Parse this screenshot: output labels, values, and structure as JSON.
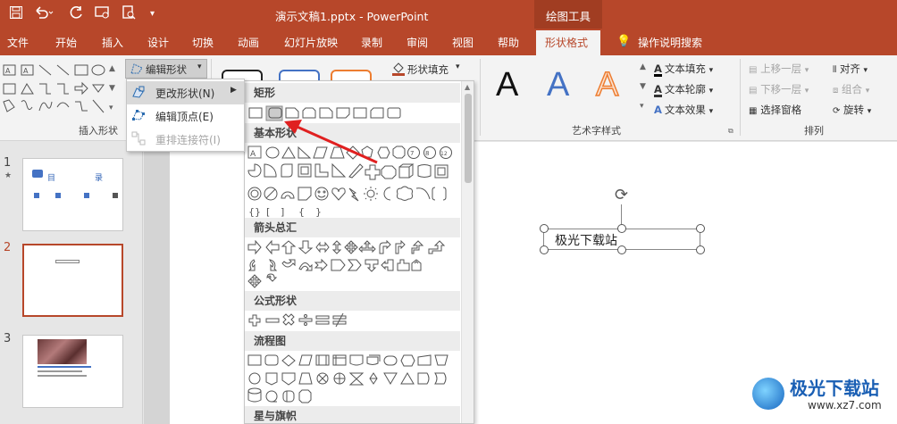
{
  "titlebar": {
    "doc_title": "演示文稿1.pptx  -  PowerPoint",
    "context_tool": "绘图工具"
  },
  "tabs": [
    "文件",
    "开始",
    "插入",
    "设计",
    "切换",
    "动画",
    "幻灯片放映",
    "录制",
    "审阅",
    "视图",
    "帮助",
    "形状格式"
  ],
  "tell_me": "操作说明搜索",
  "ribbon": {
    "edit_shape": "编辑形状",
    "shape_fill": "形状填充",
    "insert_shapes_label": "插入形状",
    "art_label": "艺术字样式",
    "arrange_label": "排列",
    "text_fill": "文本填充",
    "text_outline": "文本轮廓",
    "text_effects": "文本效果",
    "bring_forward": "上移一层",
    "send_backward": "下移一层",
    "selection_pane": "选择窗格",
    "align": "对齐",
    "group": "组合",
    "rotate": "旋转",
    "wordart_letter": "A"
  },
  "menu": {
    "change_shape": "更改形状(N)",
    "edit_points": "编辑顶点(E)",
    "reroute": "重排连接符(I)"
  },
  "gallery": {
    "sections": [
      "矩形",
      "基本形状",
      "箭头总汇",
      "公式形状",
      "流程图",
      "星与旗帜"
    ]
  },
  "slides": {
    "numbers": [
      "1",
      "2",
      "3"
    ],
    "star": "★",
    "s1_title_a": "目",
    "s1_title_b": "录"
  },
  "textbox": "极光下载站",
  "watermark": {
    "name": "极光下载站",
    "url": "www.xz7.com"
  },
  "colors": {
    "accent": "#b7472a",
    "wordart_blue": "#4472c4",
    "wordart_orange": "#ed7d31"
  }
}
